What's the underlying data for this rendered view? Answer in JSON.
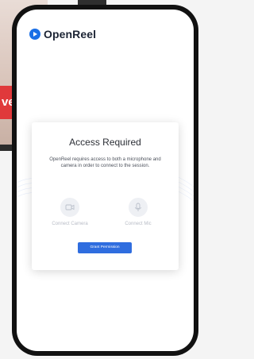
{
  "background": {
    "banner_text": "ve S"
  },
  "app": {
    "brand": "OpenReel"
  },
  "dialog": {
    "title": "Access Required",
    "description": "OpenReel requires access to both a microphone and camera in order to connect to the session.",
    "connect_camera_label": "Connect Camera",
    "connect_mic_label": "Connect Mic",
    "grant_button_label": "Grant Permission"
  },
  "colors": {
    "brand_blue": "#2f6ddf",
    "banner_red": "#e0393b",
    "phone_frame": "#111111"
  },
  "icons": {
    "logo": "openreel-logo-icon",
    "camera": "camera-icon",
    "mic": "microphone-icon"
  }
}
